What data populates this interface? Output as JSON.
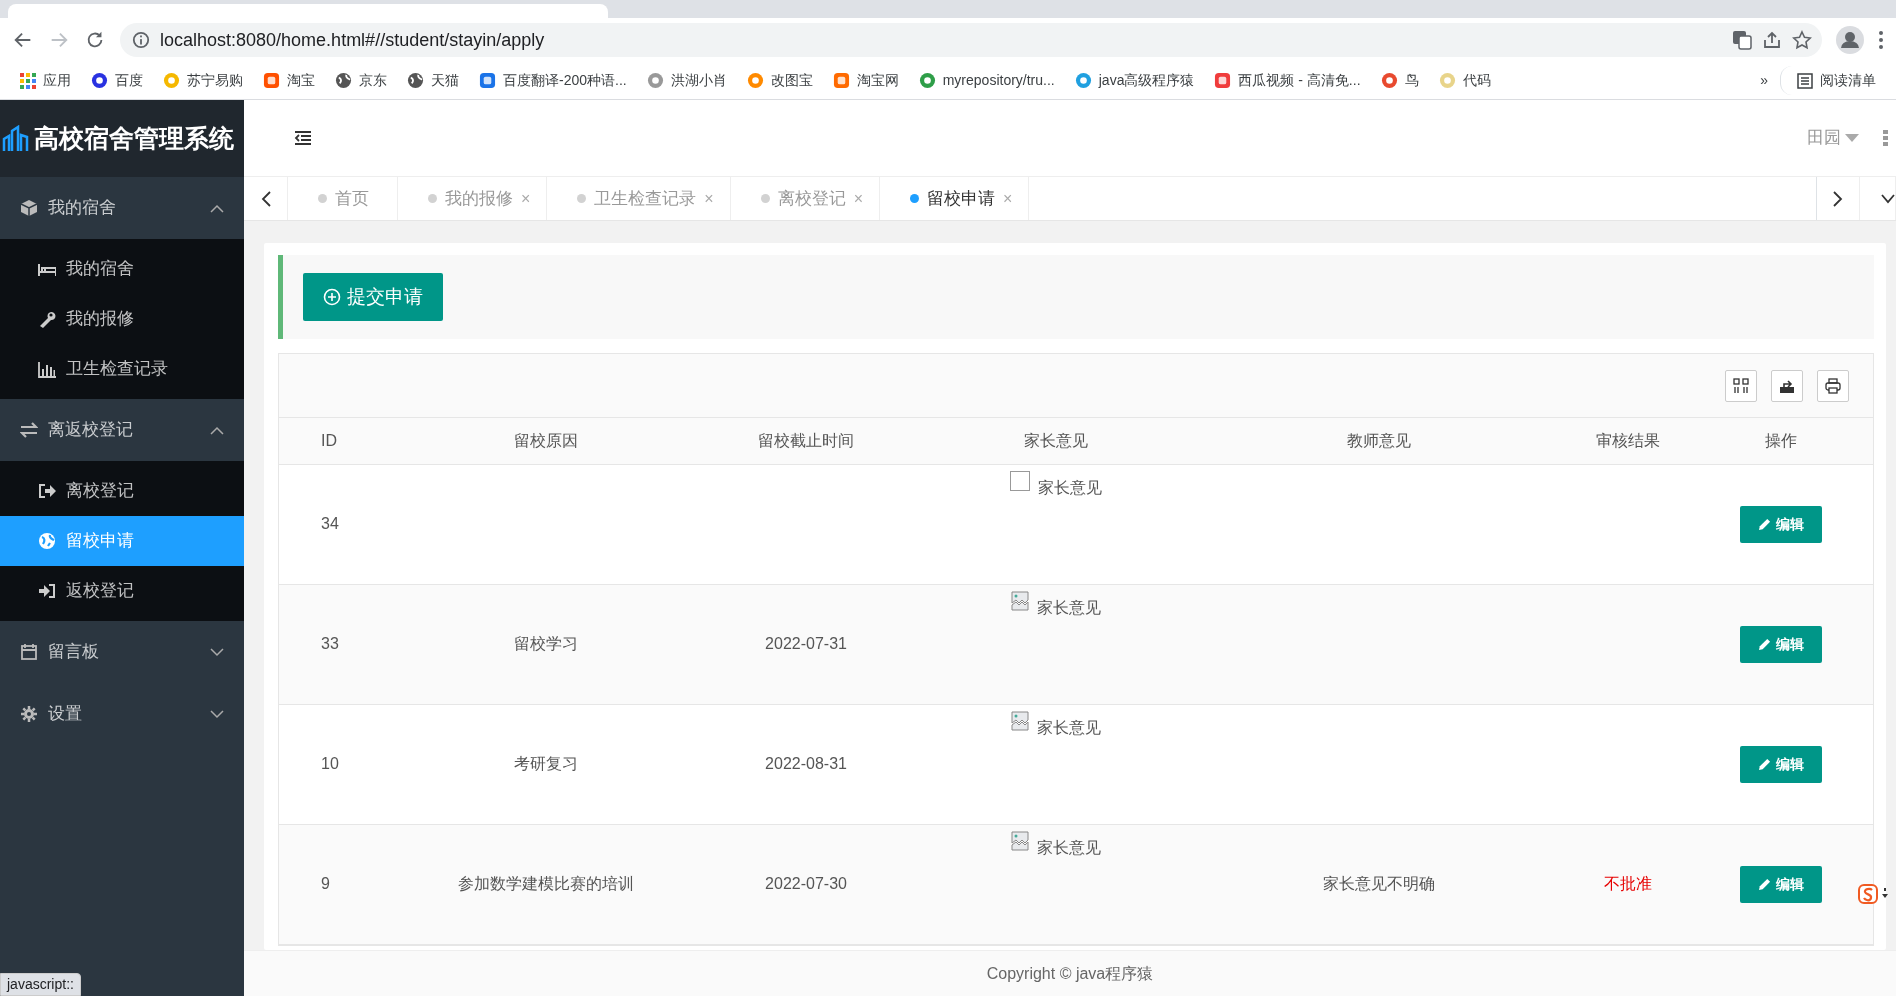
{
  "browser": {
    "url": "localhost:8080/home.html#//student/stayin/apply",
    "bookmarks": [
      {
        "label": "应用"
      },
      {
        "label": "百度"
      },
      {
        "label": "苏宁易购"
      },
      {
        "label": "淘宝"
      },
      {
        "label": "京东"
      },
      {
        "label": "天猫"
      },
      {
        "label": "百度翻译-200种语..."
      },
      {
        "label": "洪湖小肖"
      },
      {
        "label": "改图宝"
      },
      {
        "label": "淘宝网"
      },
      {
        "label": "myrepository/tru..."
      },
      {
        "label": "java高级程序猿"
      },
      {
        "label": "西瓜视频 - 高清免..."
      },
      {
        "label": "鸟"
      },
      {
        "label": "代码"
      }
    ],
    "more": "»",
    "reading_list": "阅读清单",
    "status": "javascript::"
  },
  "app": {
    "title": "高校宿舍管理系统",
    "user": "田园"
  },
  "sidebar": [
    {
      "label": "我的宿舍",
      "expanded": true,
      "children": [
        {
          "label": "我的宿舍",
          "selected": false
        },
        {
          "label": "我的报修",
          "selected": false
        },
        {
          "label": "卫生检查记录",
          "selected": false
        }
      ]
    },
    {
      "label": "离返校登记",
      "expanded": true,
      "children": [
        {
          "label": "离校登记",
          "selected": false
        },
        {
          "label": "留校申请",
          "selected": true
        },
        {
          "label": "返校登记",
          "selected": false
        }
      ]
    },
    {
      "label": "留言板",
      "expanded": false
    },
    {
      "label": "设置",
      "expanded": false
    }
  ],
  "tabs": [
    {
      "label": "首页",
      "selected": false
    },
    {
      "label": "我的报修",
      "close": "×",
      "selected": false
    },
    {
      "label": "卫生检查记录",
      "close": "×",
      "selected": false
    },
    {
      "label": "离校登记",
      "close": "×",
      "selected": false
    },
    {
      "label": "留校申请",
      "close": "×",
      "selected": true
    }
  ],
  "submit_button": "提交申请",
  "table": {
    "columns": [
      "ID",
      "留校原因",
      "留校截止时间",
      "家长意见",
      "教师意见",
      "审核结果",
      "操作"
    ],
    "rows": [
      {
        "id": "34",
        "parent_opinion": {
          "kind": "box",
          "text": "家长意见"
        },
        "action": "编辑"
      },
      {
        "id": "33",
        "reason": "留校学习",
        "deadline": "2022-07-31",
        "parent_opinion": {
          "kind": "broken",
          "text": "家长意见"
        },
        "action": "编辑"
      },
      {
        "id": "10",
        "reason": "考研复习",
        "deadline": "2022-08-31",
        "parent_opinion": {
          "kind": "broken",
          "text": "家长意见"
        },
        "action": "编辑"
      },
      {
        "id": "9",
        "reason": "参加数学建模比赛的培训",
        "deadline": "2022-07-30",
        "parent_opinion": {
          "kind": "broken",
          "text": "家长意见"
        },
        "teacher_opinion": "家长意见不明确",
        "result": "不批准",
        "action": "编辑"
      }
    ]
  },
  "footer": "Copyright © java程序猿"
}
